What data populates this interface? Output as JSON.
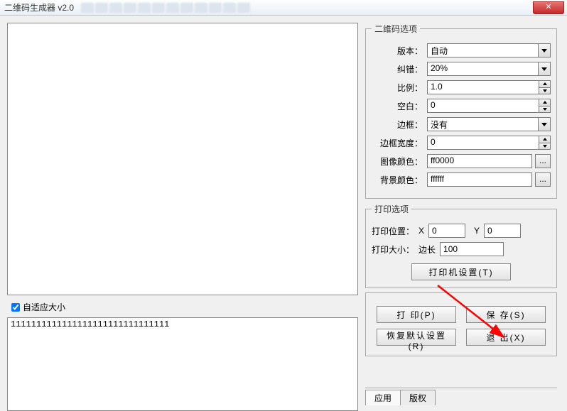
{
  "window": {
    "title": "二维码生成器 v2.0"
  },
  "left": {
    "autosize_label": "自适应大小",
    "autosize_checked": true,
    "text_value": "1111111111111111111111111111111"
  },
  "qr_options": {
    "legend": "二维码选项",
    "version_label": "版本：",
    "version_value": "自动",
    "ec_label": "纠错：",
    "ec_value": "20%",
    "scale_label": "比例：",
    "scale_value": "1.0",
    "margin_label": "空白：",
    "margin_value": "0",
    "border_label": "边框：",
    "border_value": "没有",
    "border_w_label": "边框宽度：",
    "border_w_value": "0",
    "fg_label": "图像颜色：",
    "fg_value": "ff0000",
    "bg_label": "背景颜色：",
    "bg_value": "ffffff",
    "color_btn": "..."
  },
  "print_options": {
    "legend": "打印选项",
    "pos_label": "打印位置：",
    "x_label": "X",
    "x_value": "0",
    "y_label": "Y",
    "y_value": "0",
    "size_label": "打印大小：",
    "side_label": "边长",
    "side_value": "100",
    "printer_btn": "打印机设置(T)"
  },
  "actions": {
    "print": "打  印(P)",
    "save": "保  存(S)",
    "reset": "恢复默认设置(R)",
    "exit": "退  出(X)"
  },
  "tabs": {
    "app": "应用",
    "copyright": "版权"
  }
}
